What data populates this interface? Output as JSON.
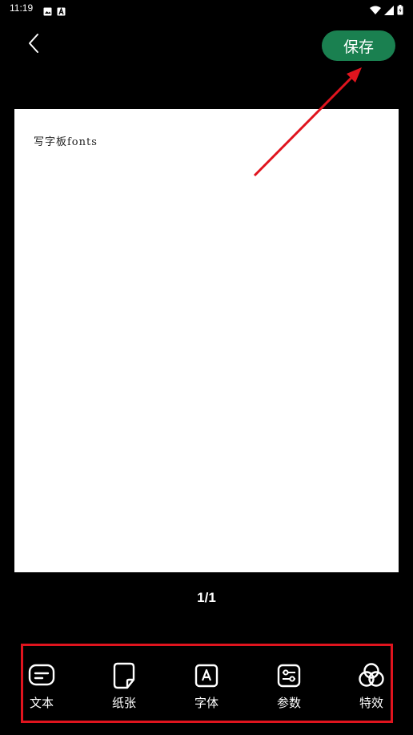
{
  "status_bar": {
    "time": "11:19",
    "left_icons": [
      "image-icon",
      "a-icon"
    ],
    "right_icons": [
      "wifi-icon",
      "signal-icon",
      "battery-icon"
    ]
  },
  "header": {
    "back_icon": "chevron-left-icon",
    "save_label": "保存",
    "save_color": "#1a8050"
  },
  "canvas": {
    "paper_text": "写字板fonts"
  },
  "pagination": {
    "label": "1/1"
  },
  "toolbar": {
    "items": [
      {
        "label": "文本",
        "icon": "text-icon"
      },
      {
        "label": "纸张",
        "icon": "paper-icon"
      },
      {
        "label": "字体",
        "icon": "font-icon"
      },
      {
        "label": "参数",
        "icon": "sliders-icon"
      },
      {
        "label": "特效",
        "icon": "effects-icon"
      }
    ]
  },
  "annotation": {
    "highlight_color": "#e0141e"
  }
}
